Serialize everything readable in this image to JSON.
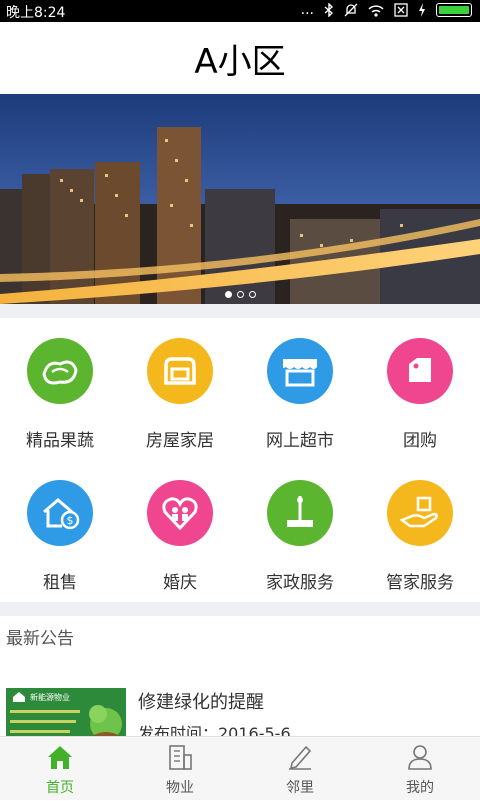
{
  "status_bar": {
    "time": "晚上8:24",
    "dots": "..."
  },
  "header": {
    "title": "A小区"
  },
  "banner": {
    "slides": 3,
    "active_slide": 1
  },
  "services": [
    {
      "label": "精品果蔬",
      "color": "#5bb52e",
      "icon": "vegetables-icon"
    },
    {
      "label": "房屋家居",
      "color": "#f5b81c",
      "icon": "sofa-icon"
    },
    {
      "label": "网上超市",
      "color": "#2f9ae6",
      "icon": "store-icon"
    },
    {
      "label": "团购",
      "color": "#f0468f",
      "icon": "tag-icon"
    },
    {
      "label": "租售",
      "color": "#2f9ae6",
      "icon": "house-money-icon"
    },
    {
      "label": "婚庆",
      "color": "#f0468f",
      "icon": "couple-heart-icon"
    },
    {
      "label": "家政服务",
      "color": "#5bb52e",
      "icon": "mop-icon"
    },
    {
      "label": "管家服务",
      "color": "#f5b81c",
      "icon": "hand-box-icon"
    }
  ],
  "notice": {
    "section_title": "最新公告",
    "items": [
      {
        "headline": "修建绿化的提醒",
        "date": "发布时间：2016-5-6",
        "thumb_text": "新能源物业"
      }
    ]
  },
  "tabbar": {
    "tabs": [
      {
        "label": "首页",
        "icon": "home-icon",
        "active": true
      },
      {
        "label": "物业",
        "icon": "building-icon",
        "active": false
      },
      {
        "label": "邻里",
        "icon": "pencil-icon",
        "active": false
      },
      {
        "label": "我的",
        "icon": "user-icon",
        "active": false
      }
    ],
    "active_color": "#43b02a"
  }
}
